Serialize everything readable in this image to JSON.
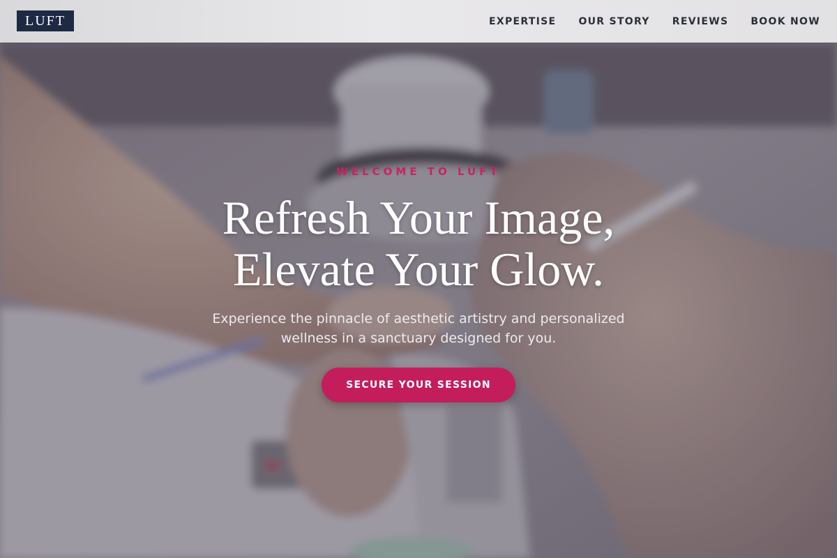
{
  "brand": {
    "logo_text": "LUFT",
    "logo_bg": "#1e2a44"
  },
  "nav": {
    "items": [
      {
        "label": "EXPERTISE"
      },
      {
        "label": "OUR STORY"
      },
      {
        "label": "REVIEWS"
      },
      {
        "label": "BOOK NOW"
      }
    ]
  },
  "hero": {
    "eyebrow": "WELCOME TO LUFT",
    "headline_line1": "Refresh Your Image,",
    "headline_line2": "Elevate Your Glow.",
    "subtext_line1": "Experience the pinnacle of aesthetic artistry and personalized",
    "subtext_line2": "wellness in a sanctuary designed for you.",
    "cta_label": "SECURE YOUR SESSION",
    "background_image": "nail-salon-manicure-photo"
  },
  "colors": {
    "accent": "#c41d5b",
    "eyebrow": "#c8245f",
    "nav_text": "#2b2f3a",
    "header_bg": "#e6e5e7"
  }
}
